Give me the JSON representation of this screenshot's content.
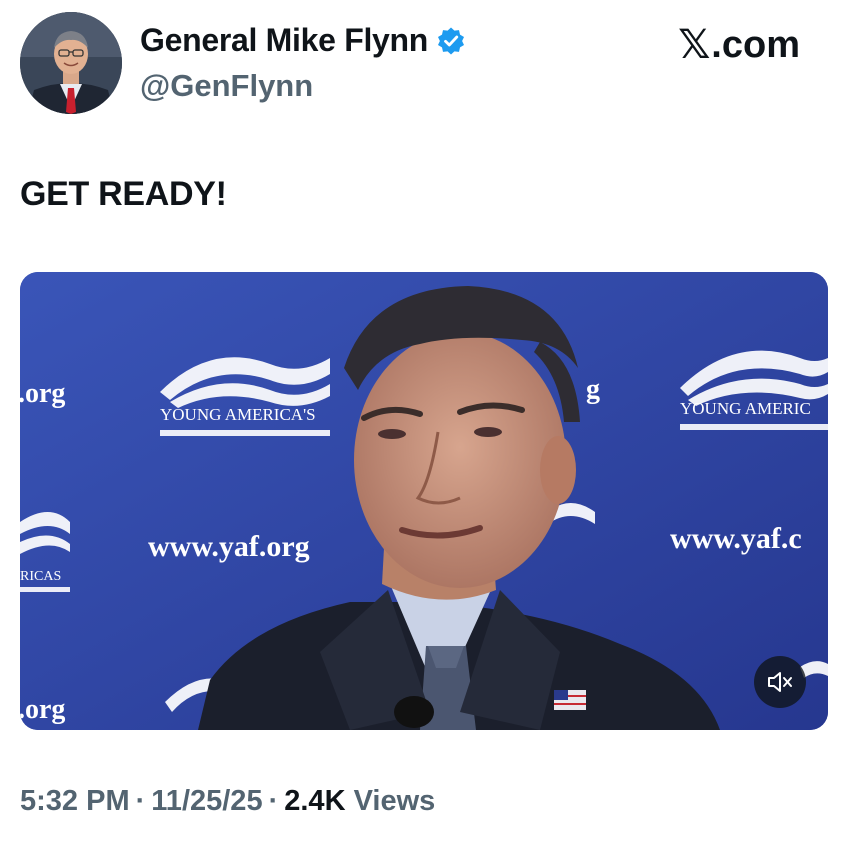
{
  "author": {
    "display_name": "General Mike Flynn",
    "handle": "@GenFlynn",
    "verified": true,
    "avatar_icon": "profile-photo"
  },
  "brand": {
    "logo_icon": "x-logo",
    "domain": ".com"
  },
  "tweet": {
    "text": "GET READY!"
  },
  "video": {
    "backdrop_texts": {
      "org_1": ".org",
      "org_2": "g",
      "org_3": ".org",
      "url_1": "www.yaf.org",
      "url_2": "www.yaf.c",
      "brand_1": "YOUNG AMERICA'S",
      "brand_2": "YOUNG AMERIC",
      "brand_3": "RICAS"
    },
    "mute_icon": "speaker-muted-icon"
  },
  "meta": {
    "time": "5:32 PM",
    "separator": "·",
    "date": "11/25/25",
    "views_count": "2.4K",
    "views_label": "Views"
  },
  "colors": {
    "verified_blue": "#1d9bf0",
    "text_primary": "#0f1419",
    "text_secondary": "#536471",
    "video_backdrop": "#2b3f9c"
  }
}
